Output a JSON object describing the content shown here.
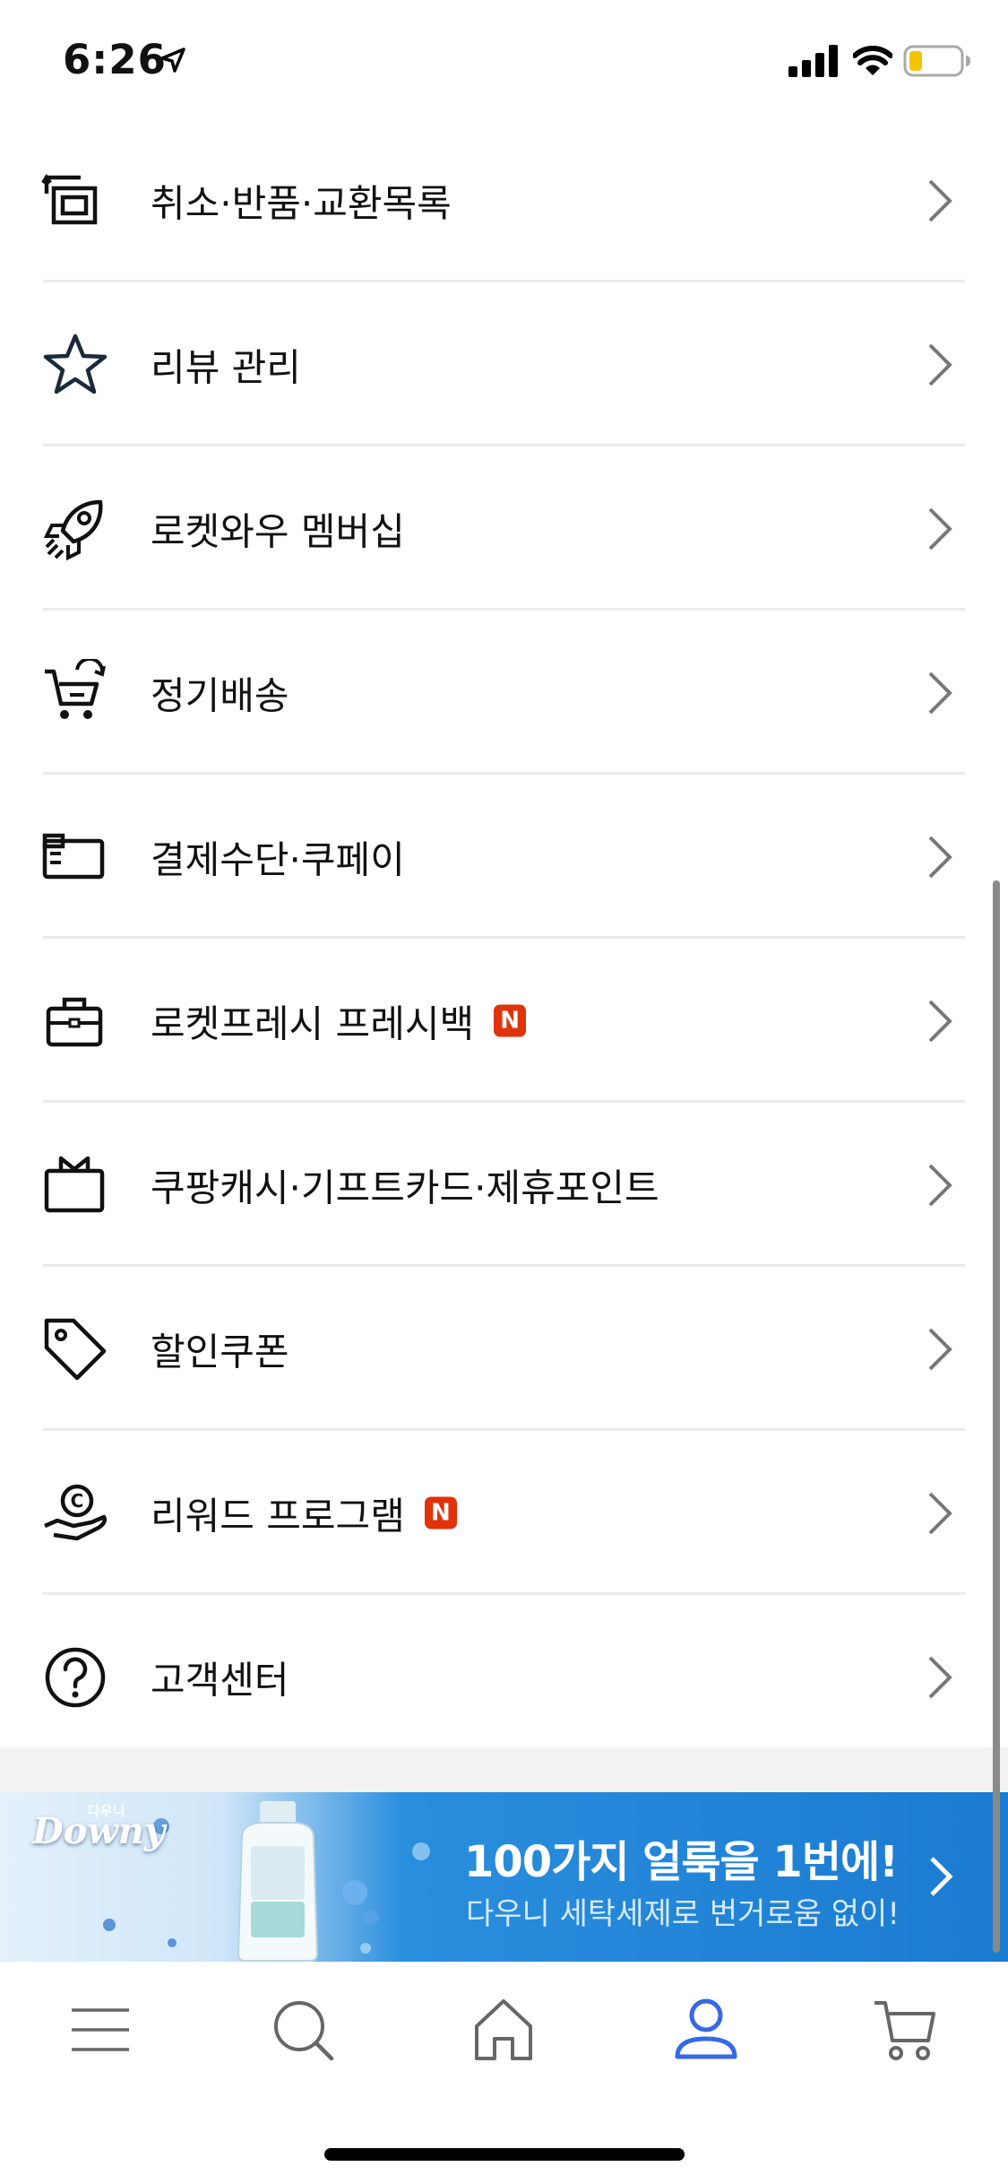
{
  "status_bar": {
    "time": "6:26",
    "icons": [
      "location-arrow-icon",
      "cellular-signal-icon",
      "wifi-icon",
      "battery-low-icon"
    ],
    "battery_color": "#f5c400"
  },
  "menu": {
    "items": [
      {
        "label": "취소·반품·교환목록",
        "icon": "return-box-icon",
        "badge": ""
      },
      {
        "label": "리뷰 관리",
        "icon": "star-icon",
        "badge": ""
      },
      {
        "label": "로켓와우 멤버십",
        "icon": "rocket-icon",
        "badge": ""
      },
      {
        "label": "정기배송",
        "icon": "subscription-cart-icon",
        "badge": ""
      },
      {
        "label": "결제수단·쿠페이",
        "icon": "wallet-card-icon",
        "badge": ""
      },
      {
        "label": "로켓프레시 프레시백",
        "icon": "fresh-bag-icon",
        "badge": "N"
      },
      {
        "label": "쿠팡캐시·기프트카드·제휴포인트",
        "icon": "gift-box-icon",
        "badge": ""
      },
      {
        "label": "할인쿠폰",
        "icon": "price-tag-icon",
        "badge": ""
      },
      {
        "label": "리워드 프로그램",
        "icon": "reward-hand-coin-icon",
        "badge": "N"
      },
      {
        "label": "고객센터",
        "icon": "help-circle-icon",
        "badge": ""
      }
    ],
    "badge_color": "#e0330a"
  },
  "banner": {
    "brand": "Downy",
    "brand_sub": "다우니",
    "headline": "100가지 얼룩을 1번에!",
    "subtext": "다우니 세탁세제로 번거로움 없이!",
    "background_color": "#1a7bd0"
  },
  "tab_bar": {
    "tabs": [
      {
        "icon": "menu-icon",
        "active": false
      },
      {
        "icon": "search-icon",
        "active": false
      },
      {
        "icon": "home-icon",
        "active": false
      },
      {
        "icon": "my-account-icon",
        "active": true
      },
      {
        "icon": "cart-icon",
        "active": false
      }
    ],
    "active_color": "#3469e8",
    "inactive_color": "#666666"
  }
}
